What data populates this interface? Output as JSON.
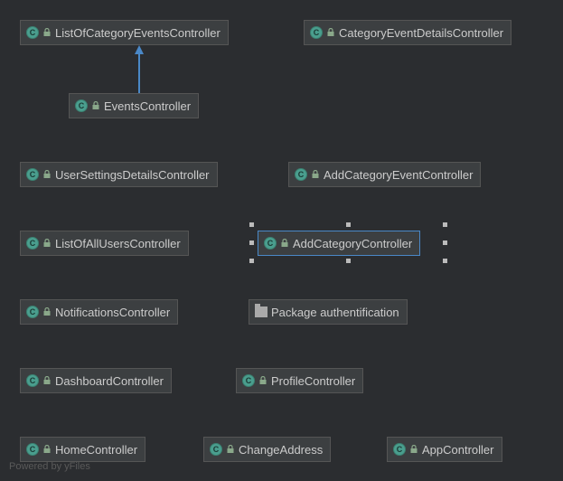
{
  "watermark": "Powered by yFiles",
  "icon_c_letter": "C",
  "nodes": {
    "listOfCategoryEvents": {
      "label": "ListOfCategoryEventsController"
    },
    "categoryEventDetails": {
      "label": "CategoryEventDetailsController"
    },
    "events": {
      "label": "EventsController"
    },
    "userSettingsDetails": {
      "label": "UserSettingsDetailsController"
    },
    "addCategoryEvent": {
      "label": "AddCategoryEventController"
    },
    "listOfAllUsers": {
      "label": "ListOfAllUsersController"
    },
    "addCategory": {
      "label": "AddCategoryController"
    },
    "notifications": {
      "label": "NotificationsController"
    },
    "packageAuth": {
      "label": "Package authentification"
    },
    "dashboard": {
      "label": "DashboardController"
    },
    "profile": {
      "label": "ProfileController"
    },
    "home": {
      "label": "HomeController"
    },
    "changeAddress": {
      "label": "ChangeAddress"
    },
    "app": {
      "label": "AppController"
    }
  },
  "edges": [
    {
      "from": "events",
      "to": "listOfCategoryEvents"
    }
  ],
  "selected_node": "addCategory"
}
